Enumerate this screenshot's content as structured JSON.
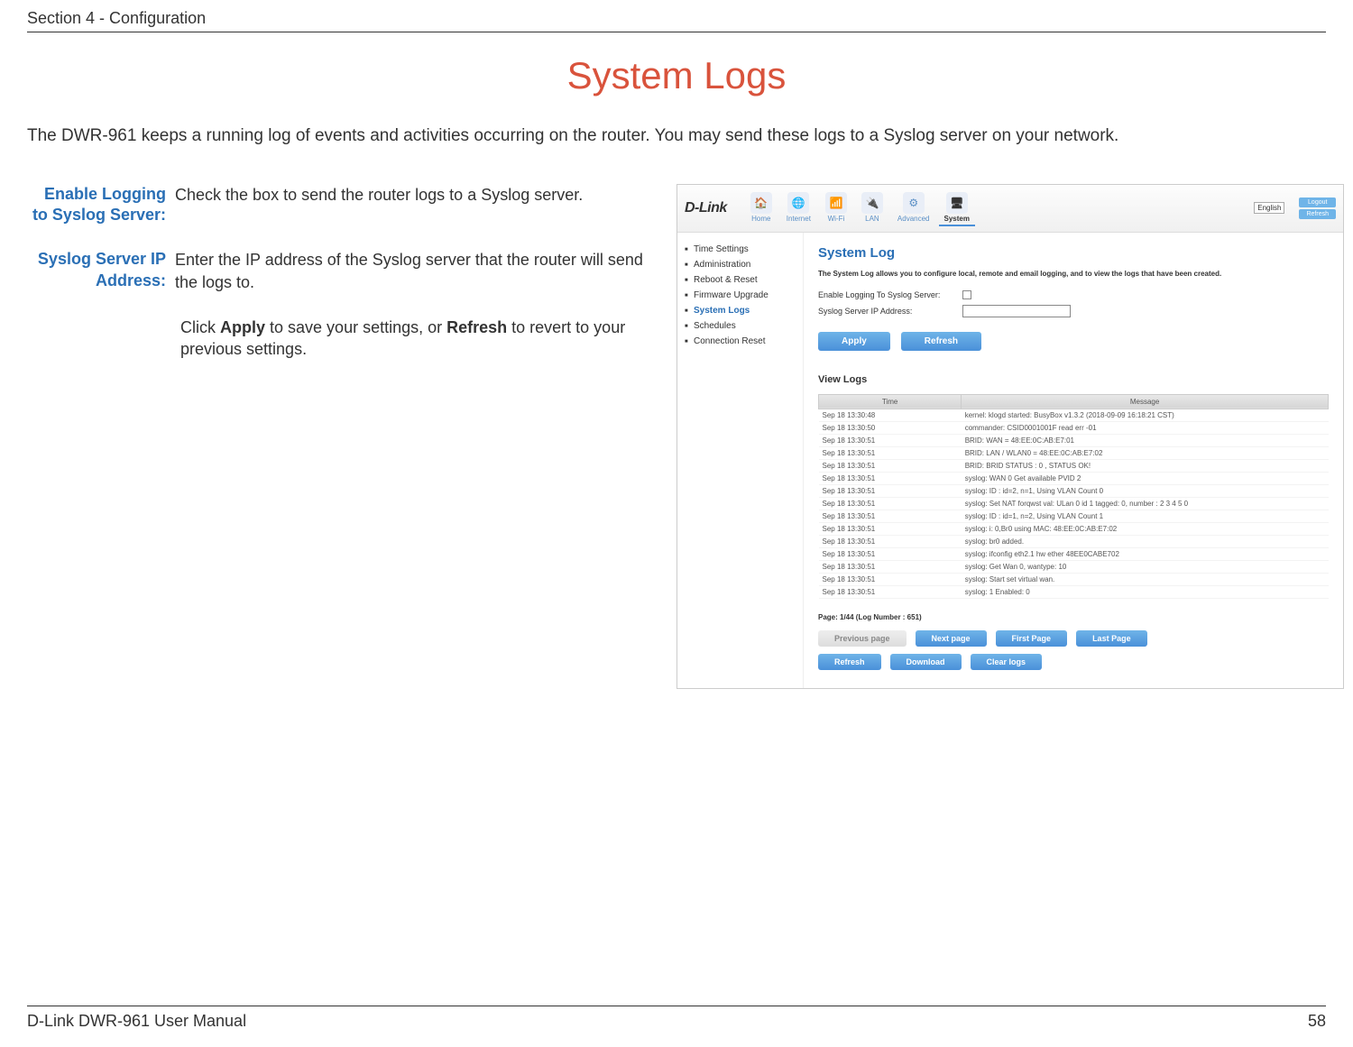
{
  "header": {
    "section": "Section 4 - Configuration"
  },
  "title": "System Logs",
  "intro": "The DWR-961 keeps a running log of events and activities occurring on the router. You may send these logs to a Syslog server on your network.",
  "defs": {
    "row1": {
      "label": "Enable Logging to Syslog Server:",
      "text": "Check the box to send the router logs to a Syslog server."
    },
    "row2": {
      "label": "Syslog Server IP Address:",
      "text": "Enter the IP address of the Syslog server that the router will send the logs to."
    }
  },
  "note": {
    "pre": "Click ",
    "b1": "Apply",
    "mid": " to save your settings, or ",
    "b2": "Refresh",
    "post": " to revert to your previous settings."
  },
  "ui": {
    "logo": "D-Link",
    "tabs": {
      "home": "Home",
      "internet": "Internet",
      "wifi": "Wi-Fi",
      "lan": "LAN",
      "advanced": "Advanced",
      "system": "System"
    },
    "lang": "English",
    "corner": {
      "logout": "Logout",
      "refresh": "Refresh"
    },
    "side": {
      "i0": "Time Settings",
      "i1": "Administration",
      "i2": "Reboot & Reset",
      "i3": "Firmware Upgrade",
      "i4": "System Logs",
      "i5": "Schedules",
      "i6": "Connection Reset"
    },
    "panel": {
      "title": "System Log",
      "desc": "The System Log allows you to configure local, remote and email logging, and to view the logs that have been created.",
      "form": {
        "enable": "Enable Logging To Syslog Server:",
        "ip": "Syslog Server IP Address:"
      },
      "btns": {
        "apply": "Apply",
        "refresh": "Refresh"
      },
      "viewlogs": "View Logs",
      "th": {
        "time": "Time",
        "msg": "Message"
      },
      "rows": [
        {
          "t": "Sep 18 13:30:48",
          "m": "kernel: klogd started: BusyBox v1.3.2 (2018-09-09 16:18:21 CST)"
        },
        {
          "t": "Sep 18 13:30:50",
          "m": "commander: CSID0001001F read err -01"
        },
        {
          "t": "Sep 18 13:30:51",
          "m": "BRID: WAN = 48:EE:0C:AB:E7:01"
        },
        {
          "t": "Sep 18 13:30:51",
          "m": "BRID: LAN / WLAN0 = 48:EE:0C:AB:E7:02"
        },
        {
          "t": "Sep 18 13:30:51",
          "m": "BRID: BRID STATUS : 0 , STATUS OK!"
        },
        {
          "t": "Sep 18 13:30:51",
          "m": "syslog: WAN 0 Get available PVID 2"
        },
        {
          "t": "Sep 18 13:30:51",
          "m": "syslog: ID : id=2, n=1, Using VLAN Count 0"
        },
        {
          "t": "Sep 18 13:30:51",
          "m": "syslog: Set NAT forqwst val: ULan 0 id 1 tagged: 0, number : 2 3 4 5 0"
        },
        {
          "t": "Sep 18 13:30:51",
          "m": "syslog: ID : id=1, n=2, Using VLAN Count 1"
        },
        {
          "t": "Sep 18 13:30:51",
          "m": "syslog: i: 0,Br0 using MAC: 48:EE:0C:AB:E7:02"
        },
        {
          "t": "Sep 18 13:30:51",
          "m": "syslog: br0 added."
        },
        {
          "t": "Sep 18 13:30:51",
          "m": "syslog: ifconfig eth2.1 hw ether 48EE0CABE702"
        },
        {
          "t": "Sep 18 13:30:51",
          "m": "syslog: Get Wan 0, wantype: 10"
        },
        {
          "t": "Sep 18 13:30:51",
          "m": "syslog: Start set virtual wan."
        },
        {
          "t": "Sep 18 13:30:51",
          "m": "syslog: 1 Enabled: 0"
        }
      ],
      "pageinfo": "Page: 1/44 (Log Number : 651)",
      "nav": {
        "prev": "Previous page",
        "next": "Next page",
        "first": "First Page",
        "last": "Last Page",
        "refresh": "Refresh",
        "download": "Download",
        "clear": "Clear logs"
      }
    }
  },
  "footer": {
    "left": "D-Link DWR-961 User Manual",
    "right": "58"
  }
}
